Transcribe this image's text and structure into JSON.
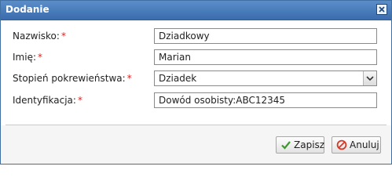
{
  "dialog": {
    "title": "Dodanie",
    "close_icon": "close-icon"
  },
  "form": {
    "fields": [
      {
        "label": "Nazwisko:",
        "required_mark": "*",
        "value": "Dziadkowy",
        "type": "text"
      },
      {
        "label": "Imię:",
        "required_mark": "*",
        "value": "Marian",
        "type": "text"
      },
      {
        "label": "Stopień pokrewieństwa:",
        "required_mark": "*",
        "value": "Dziadek",
        "type": "select"
      },
      {
        "label": "Identyfikacja:",
        "required_mark": "*",
        "value": "Dowód osobisty:ABC12345",
        "type": "text"
      }
    ]
  },
  "footer": {
    "save_label": "Zapisz",
    "save_icon": "checkmark-icon",
    "cancel_label": "Anuluj",
    "cancel_icon": "cancel-icon"
  },
  "colors": {
    "titlebar": "#3a6cae",
    "required": "#dd2222",
    "save_check": "#3a9a2a",
    "cancel_icon": "#d23b2b"
  }
}
